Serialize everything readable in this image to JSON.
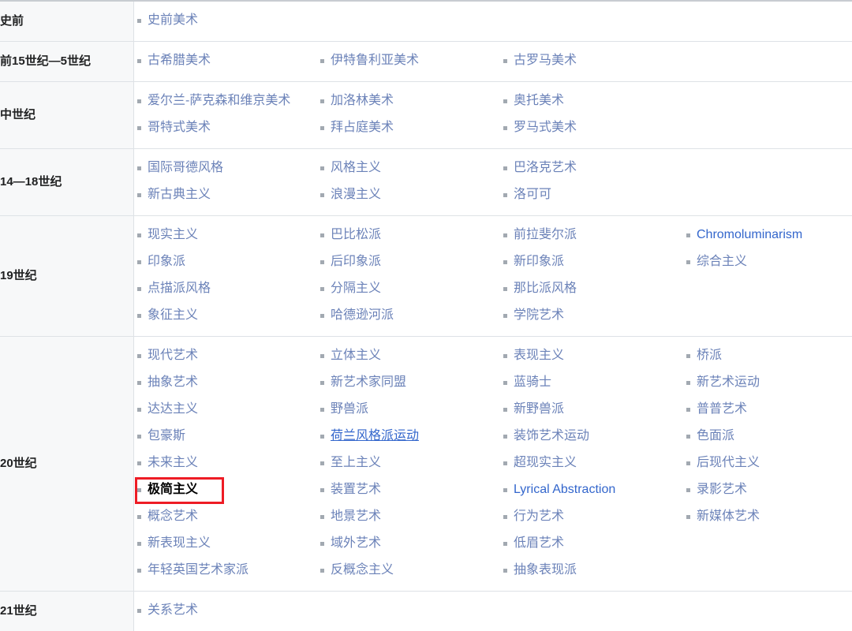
{
  "table": {
    "name": "art-movements-navbox",
    "columns": 4,
    "colors": {
      "link": "#6b82b8",
      "link_strong": "#3366cc",
      "highlight_box": "#ee1c25",
      "period_bg": "#f7f8f9",
      "row_border": "#dee2e6",
      "bullet": "#a2a9b1",
      "current_text": "#000000"
    },
    "bullet_icon": "square-bullet-icon",
    "rows": [
      {
        "period": "史前",
        "items": [
          {
            "label": "史前美术",
            "state": "link"
          }
        ]
      },
      {
        "period": "前15世纪—5世纪",
        "items": [
          {
            "label": "古希腊美术",
            "state": "link"
          },
          {
            "label": "伊特鲁利亚美术",
            "state": "link"
          },
          {
            "label": "古罗马美术",
            "state": "link"
          }
        ]
      },
      {
        "period": "中世纪",
        "items": [
          {
            "label": "爱尔兰-萨克森和维京美术",
            "state": "link"
          },
          {
            "label": "哥特式美术",
            "state": "link"
          },
          {
            "label": "加洛林美术",
            "state": "link"
          },
          {
            "label": "拜占庭美术",
            "state": "link"
          },
          {
            "label": "奥托美术",
            "state": "link"
          },
          {
            "label": "罗马式美术",
            "state": "link"
          }
        ]
      },
      {
        "period": "14—18世纪",
        "items": [
          {
            "label": "国际哥德风格",
            "state": "link"
          },
          {
            "label": "新古典主义",
            "state": "link"
          },
          {
            "label": "风格主义",
            "state": "link"
          },
          {
            "label": "浪漫主义",
            "state": "link"
          },
          {
            "label": "巴洛克艺术",
            "state": "link"
          },
          {
            "label": "洛可可",
            "state": "link"
          }
        ]
      },
      {
        "period": "19世纪",
        "items": [
          {
            "label": "现实主义",
            "state": "link"
          },
          {
            "label": "印象派",
            "state": "link"
          },
          {
            "label": "点描派风格",
            "state": "link"
          },
          {
            "label": "象征主义",
            "state": "link"
          },
          {
            "label": "巴比松派",
            "state": "link"
          },
          {
            "label": "后印象派",
            "state": "link"
          },
          {
            "label": "分隔主义",
            "state": "link"
          },
          {
            "label": "哈德逊河派",
            "state": "link"
          },
          {
            "label": "前拉斐尔派",
            "state": "link"
          },
          {
            "label": "新印象派",
            "state": "link"
          },
          {
            "label": "那比派风格",
            "state": "link"
          },
          {
            "label": "学院艺术",
            "state": "link"
          },
          {
            "label": "Chromoluminarism",
            "state": "link-strong"
          },
          {
            "label": "综合主义",
            "state": "link"
          }
        ]
      },
      {
        "period": "20世纪",
        "items": [
          {
            "label": "现代艺术",
            "state": "link"
          },
          {
            "label": "抽象艺术",
            "state": "link"
          },
          {
            "label": "达达主义",
            "state": "link"
          },
          {
            "label": "包豪斯",
            "state": "link"
          },
          {
            "label": "未来主义",
            "state": "link"
          },
          {
            "label": "极简主义",
            "state": "current"
          },
          {
            "label": "概念艺术",
            "state": "link"
          },
          {
            "label": "新表现主义",
            "state": "link"
          },
          {
            "label": "年轻英国艺术家派",
            "state": "link"
          },
          {
            "label": "立体主义",
            "state": "link"
          },
          {
            "label": "新艺术家同盟",
            "state": "link"
          },
          {
            "label": "野兽派",
            "state": "link"
          },
          {
            "label": "荷兰风格派运动",
            "state": "hovered"
          },
          {
            "label": "至上主义",
            "state": "link"
          },
          {
            "label": "装置艺术",
            "state": "link"
          },
          {
            "label": "地景艺术",
            "state": "link"
          },
          {
            "label": "域外艺术",
            "state": "link"
          },
          {
            "label": "反概念主义",
            "state": "link"
          },
          {
            "label": "表现主义",
            "state": "link"
          },
          {
            "label": "蓝骑士",
            "state": "link"
          },
          {
            "label": "新野兽派",
            "state": "link"
          },
          {
            "label": "装饰艺术运动",
            "state": "link"
          },
          {
            "label": "超现实主义",
            "state": "link"
          },
          {
            "label": "Lyrical Abstraction",
            "state": "link-strong"
          },
          {
            "label": "行为艺术",
            "state": "link"
          },
          {
            "label": "低眉艺术",
            "state": "link"
          },
          {
            "label": "抽象表现派",
            "state": "link"
          },
          {
            "label": "桥派",
            "state": "link"
          },
          {
            "label": "新艺术运动",
            "state": "link"
          },
          {
            "label": "普普艺术",
            "state": "link"
          },
          {
            "label": "色面派",
            "state": "link"
          },
          {
            "label": "后现代主义",
            "state": "link"
          },
          {
            "label": "录影艺术",
            "state": "link"
          },
          {
            "label": "新媒体艺术",
            "state": "link"
          }
        ]
      },
      {
        "period": "21世纪",
        "items": [
          {
            "label": "关系艺术",
            "state": "link"
          }
        ]
      }
    ]
  }
}
